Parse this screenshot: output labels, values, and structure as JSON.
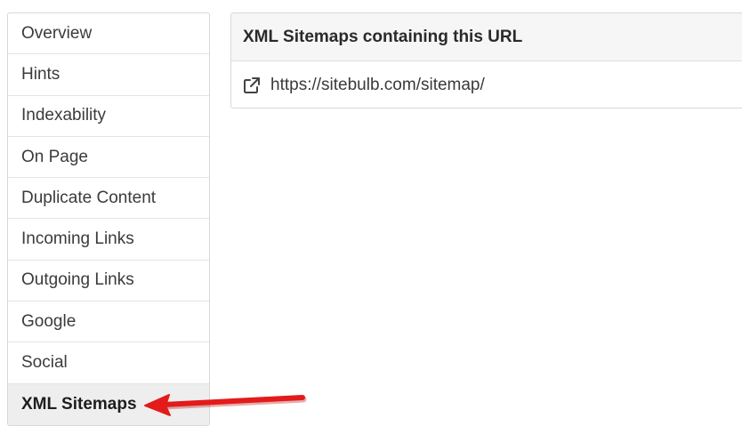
{
  "sidebar": {
    "items": [
      {
        "label": "Overview"
      },
      {
        "label": "Hints"
      },
      {
        "label": "Indexability"
      },
      {
        "label": "On Page"
      },
      {
        "label": "Duplicate Content"
      },
      {
        "label": "Incoming Links"
      },
      {
        "label": "Outgoing Links"
      },
      {
        "label": "Google"
      },
      {
        "label": "Social"
      },
      {
        "label": "XML Sitemaps",
        "active": true
      }
    ]
  },
  "panel": {
    "title": "XML Sitemaps containing this URL",
    "links": [
      {
        "url": "https://sitebulb.com/sitemap/",
        "icon": "external-link-icon"
      }
    ]
  },
  "annotation": {
    "icon": "red-arrow-icon",
    "color": "#e31b1b"
  }
}
